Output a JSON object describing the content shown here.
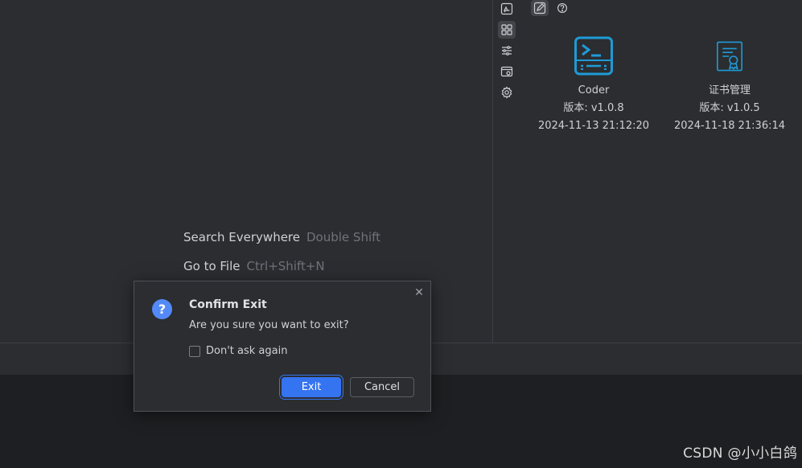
{
  "editor": {
    "hints": [
      {
        "label": "Search Everywhere",
        "shortcut": "Double Shift"
      },
      {
        "label": "Go to File",
        "shortcut": "Ctrl+Shift+N"
      }
    ]
  },
  "side_toolbar": {
    "icons": [
      "recycle-icon",
      "grid-icon",
      "sliders-icon",
      "browser-window-icon",
      "gear-icon"
    ],
    "active_index": 1
  },
  "top_tools": {
    "icons": [
      "edit-icon",
      "help-icon"
    ],
    "active_index": 0
  },
  "apps": [
    {
      "name": "Coder",
      "version": "版本: v1.0.8",
      "date": "2024-11-13 21:12:20",
      "icon": "terminal-icon"
    },
    {
      "name": "证书管理",
      "version": "版本: v1.0.5",
      "date": "2024-11-18 21:36:14",
      "icon": "certificate-icon"
    }
  ],
  "dialog": {
    "title": "Confirm Exit",
    "message": "Are you sure you want to exit?",
    "checkbox_label": "Don't ask again",
    "checkbox_checked": false,
    "exit_label": "Exit",
    "cancel_label": "Cancel",
    "close_glyph": "✕",
    "question_glyph": "?"
  },
  "watermark": "CSDN @小小白鸽",
  "colors": {
    "accent": "#3574f0",
    "app_icon_blue": "#1e9bd7",
    "question_icon": "#548af7"
  }
}
